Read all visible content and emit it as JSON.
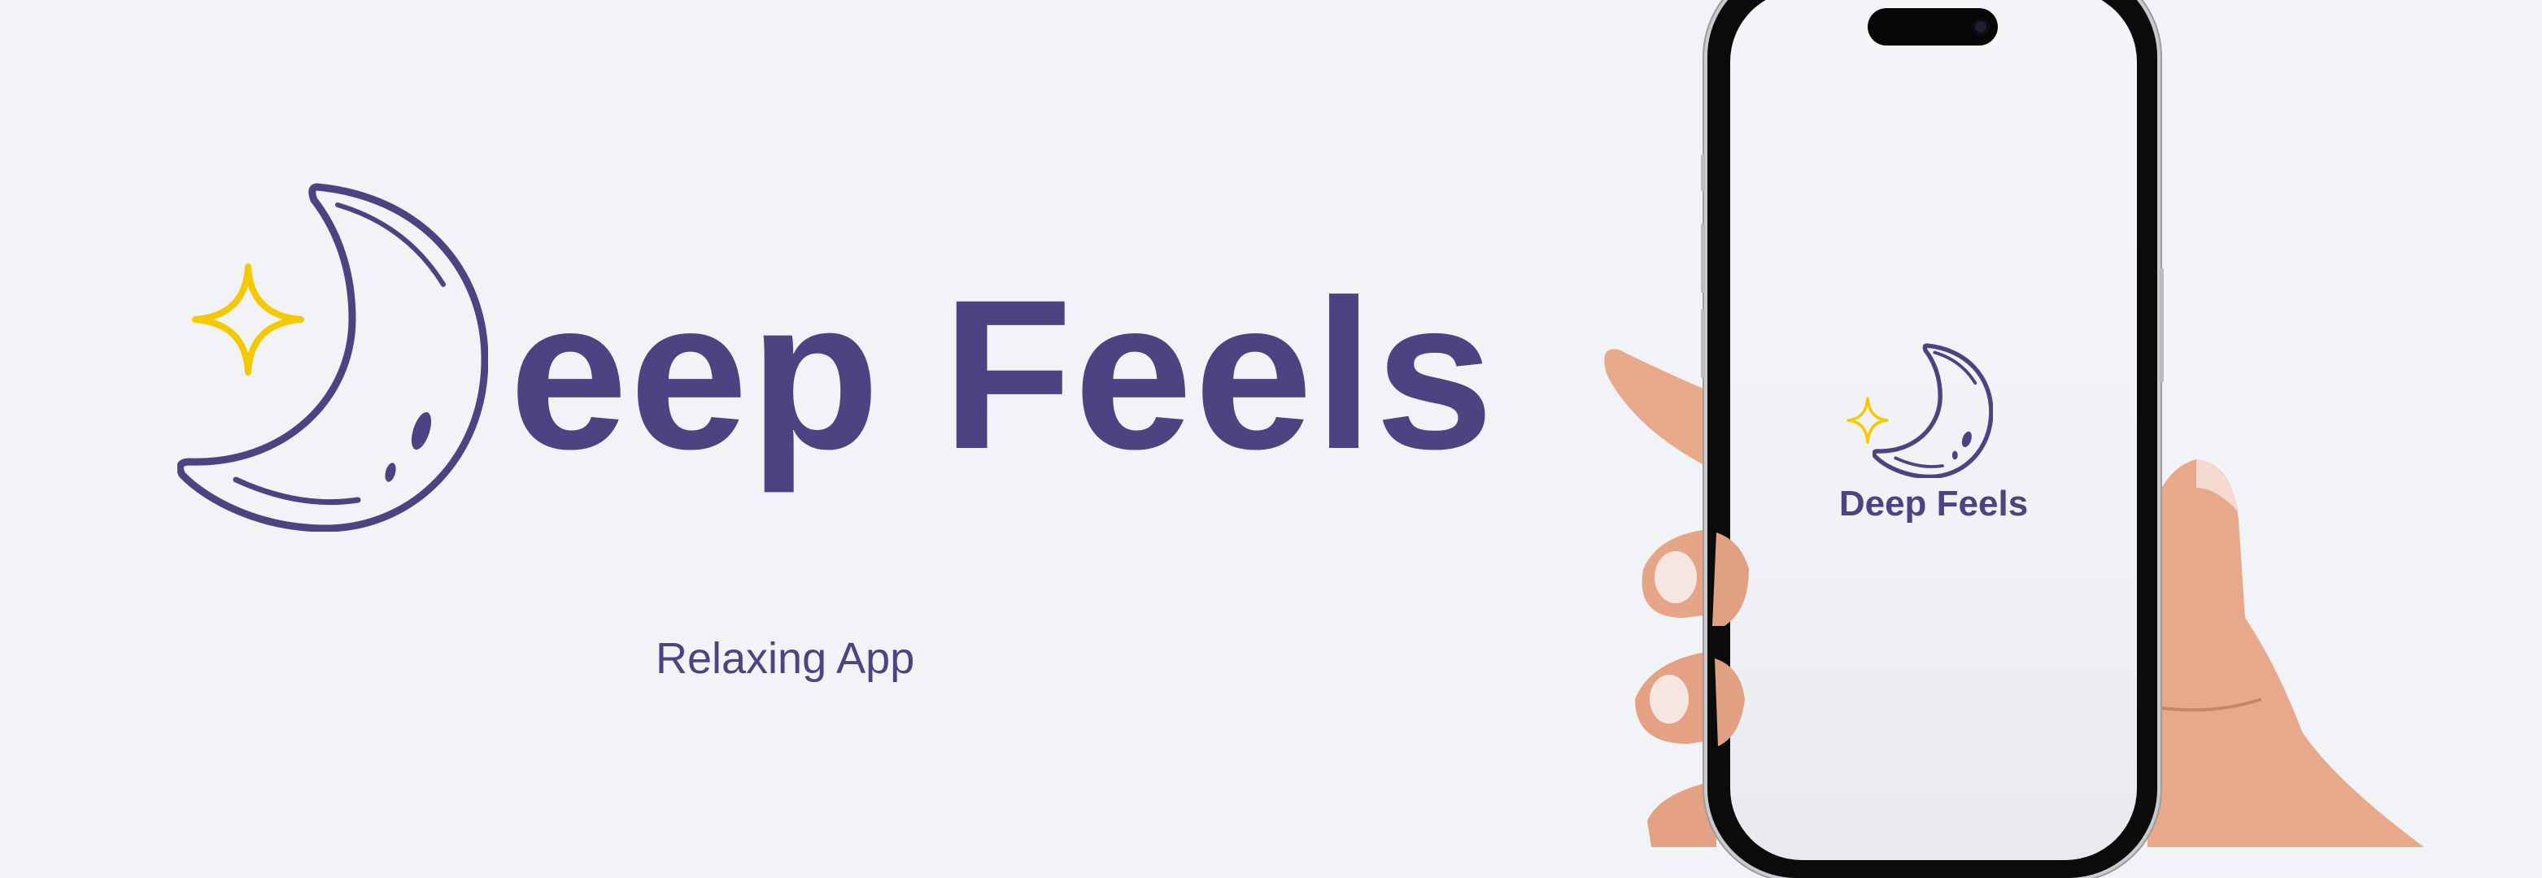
{
  "brand": {
    "name": "Deep Feels",
    "name_text_after_logo": "eep Feels",
    "tagline": "Relaxing App",
    "logo_icon": "crescent-moon-with-star"
  },
  "phone": {
    "screen_title": "Deep Feels",
    "screen_icon": "crescent-moon-with-star"
  },
  "colors": {
    "brand_purple": "#4F4283",
    "star_yellow": "#F5C900",
    "background": "#F2F3F7"
  }
}
